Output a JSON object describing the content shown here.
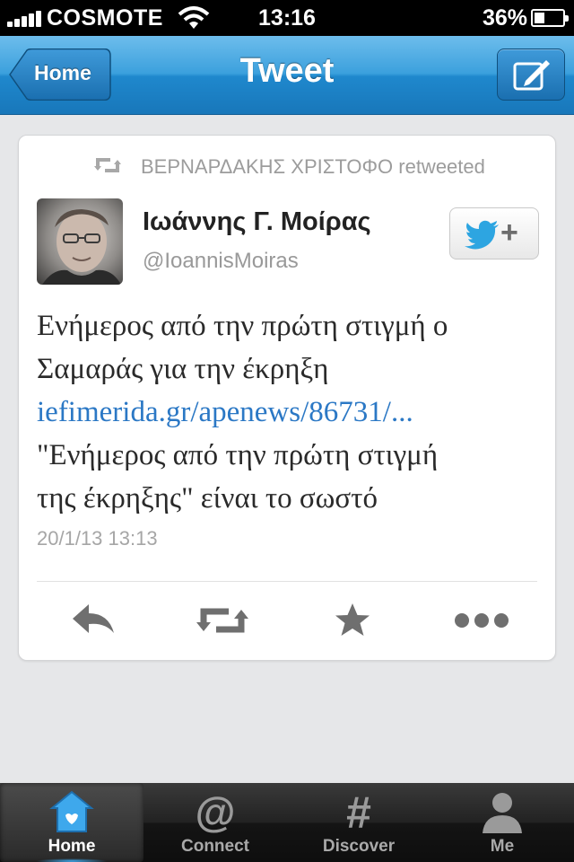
{
  "status_bar": {
    "carrier": "COSMOTE",
    "time": "13:16",
    "battery": "36%",
    "battery_level": 0.36
  },
  "nav": {
    "title": "Tweet",
    "back_label": "Home",
    "compose_icon": "compose-icon"
  },
  "tweet": {
    "retweeted_by": "ΒΕΡΝΑΡΔΑΚΗΣ ΧΡΙΣΤΟΦΟ retweeted",
    "author_name": "Ιωάννης Γ. Μοίρας",
    "author_handle": "@IoannisMoiras",
    "text_line_1": "Ενήμερος από την πρώτη στιγμή ο",
    "text_line_2": "Σαμαράς για την έκρηξη",
    "link": "iefimerida.gr/apenews/86731/...",
    "text_line_4": "\"Ενήμερος από την πρώτη στιγμή",
    "text_line_5": "της έκρηξης\" είναι το σωστό",
    "timestamp": "20/1/13 13:13",
    "link_color": "#2b78c5"
  },
  "actions": [
    "reply-icon",
    "retweet-icon",
    "favorite-icon",
    "more-icon"
  ],
  "tabs": [
    {
      "label": "Home",
      "icon": "home-icon",
      "active": true
    },
    {
      "label": "Connect",
      "icon": "at-icon",
      "active": false
    },
    {
      "label": "Discover",
      "icon": "hash-icon",
      "active": false
    },
    {
      "label": "Me",
      "icon": "person-icon",
      "active": false
    }
  ],
  "colors": {
    "nav_blue": "#1f88cd",
    "twitter_blue": "#2da5e1"
  }
}
